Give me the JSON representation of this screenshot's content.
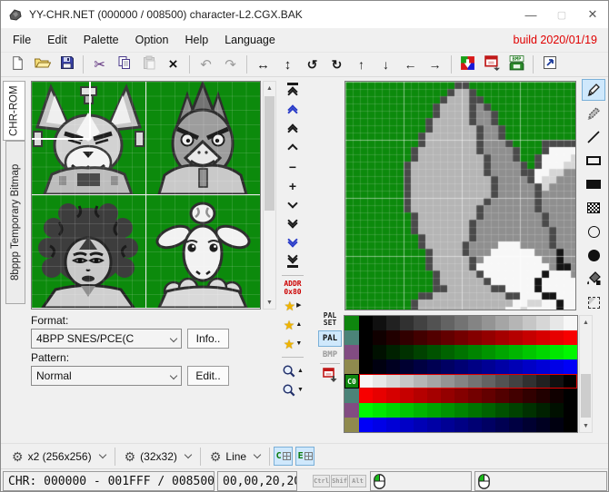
{
  "window": {
    "title": "YY-CHR.NET (000000 / 008500) character-L2.CGX.BAK",
    "build": "build 2020/01/19",
    "minimize_glyph": "—",
    "maximize_glyph": "▢",
    "close_glyph": "✕"
  },
  "menu": [
    "File",
    "Edit",
    "Palette",
    "Option",
    "Help",
    "Language"
  ],
  "toolbar": [
    {
      "icon": "new-file-icon",
      "enabled": true
    },
    {
      "icon": "open-file-icon",
      "enabled": true
    },
    {
      "icon": "save-file-icon",
      "enabled": true
    },
    {
      "type": "sep"
    },
    {
      "icon": "cut-icon",
      "enabled": true
    },
    {
      "icon": "copy-icon",
      "enabled": true
    },
    {
      "icon": "paste-icon",
      "enabled": false
    },
    {
      "icon": "delete-icon",
      "enabled": true
    },
    {
      "type": "sep"
    },
    {
      "icon": "undo-icon",
      "enabled": false
    },
    {
      "icon": "redo-icon",
      "enabled": false
    },
    {
      "type": "sep"
    },
    {
      "icon": "flip-horizontal-icon",
      "enabled": true
    },
    {
      "icon": "flip-vertical-icon",
      "enabled": true
    },
    {
      "icon": "rotate-left-icon",
      "enabled": true
    },
    {
      "icon": "rotate-right-icon",
      "enabled": true
    },
    {
      "icon": "shift-up-icon",
      "enabled": true
    },
    {
      "icon": "shift-down-icon",
      "enabled": true
    },
    {
      "icon": "shift-left-icon",
      "enabled": true
    },
    {
      "icon": "shift-right-icon",
      "enabled": true
    },
    {
      "type": "sep"
    },
    {
      "icon": "palette-editor-icon",
      "enabled": true
    },
    {
      "icon": "screen-capture-icon",
      "enabled": true
    },
    {
      "icon": "bmp-export-icon",
      "enabled": true
    },
    {
      "type": "sep"
    },
    {
      "icon": "popout-window-icon",
      "enabled": true
    }
  ],
  "tabs": [
    {
      "label": "CHR-ROM",
      "active": true
    },
    {
      "label": "8bppp Temporary Bitmap",
      "active": false
    }
  ],
  "nav": {
    "buttons": [
      {
        "icon": "jump-top-icon"
      },
      {
        "icon": "page-up-fast-icon"
      },
      {
        "icon": "page-up-8-icon"
      },
      {
        "icon": "row-up-icon"
      },
      {
        "icon": "minus-icon"
      },
      {
        "icon": "plus-icon"
      },
      {
        "icon": "row-down-icon"
      },
      {
        "icon": "page-down-8-icon"
      },
      {
        "icon": "page-down-fast-icon"
      },
      {
        "icon": "jump-bottom-icon"
      }
    ],
    "addr_line1": "ADDR",
    "addr_line2": "0x80",
    "bookmarks": [
      {
        "icon": "bookmark-go-icon",
        "arrow": "▶"
      },
      {
        "icon": "bookmark-prev-icon",
        "arrow": "▲"
      },
      {
        "icon": "bookmark-next-icon",
        "arrow": "▼"
      }
    ],
    "zoom_buttons": [
      {
        "icon": "zoom-in-icon",
        "arrow": "▲"
      },
      {
        "icon": "zoom-out-icon",
        "arrow": "▼"
      }
    ]
  },
  "tools": [
    {
      "icon": "pen-icon",
      "selected": true
    },
    {
      "icon": "dither-pen-icon",
      "selected": false
    },
    {
      "icon": "line-icon",
      "selected": false
    },
    {
      "icon": "rect-outline-icon",
      "selected": false
    },
    {
      "icon": "rect-fill-icon",
      "selected": false
    },
    {
      "icon": "dither-rect-icon",
      "selected": false
    },
    {
      "icon": "circle-outline-icon",
      "selected": false
    },
    {
      "icon": "circle-fill-icon",
      "selected": false
    },
    {
      "icon": "fill-bucket-icon",
      "selected": false
    },
    {
      "icon": "select-marquee-icon",
      "selected": false
    }
  ],
  "format": {
    "format_label": "Format:",
    "format_value": "4BPP SNES/PCE(C",
    "info_label": "Info..",
    "pattern_label": "Pattern:",
    "pattern_value": "Normal",
    "edit_label": "Edit.."
  },
  "palette": {
    "pal_set_label": "PAL SET",
    "pal_label": "PAL",
    "bmp_label": "BMP",
    "selected_row_label": "C0",
    "rows": [
      {
        "indicator": "#0e860e",
        "selected": false,
        "colors": [
          "#000000",
          "#101010",
          "#212121",
          "#313131",
          "#424242",
          "#525252",
          "#636363",
          "#737373",
          "#848484",
          "#949494",
          "#a5a5a5",
          "#b5b5b5",
          "#c6c6c6",
          "#d6d6d6",
          "#e7e7e7",
          "#f7f7f7"
        ]
      },
      {
        "indicator": "#4b8378",
        "selected": false,
        "colors": [
          "#000000",
          "#100000",
          "#210000",
          "#310000",
          "#420000",
          "#520000",
          "#630000",
          "#730000",
          "#840000",
          "#940000",
          "#a50000",
          "#b50000",
          "#c60000",
          "#d60000",
          "#e70000",
          "#f70000"
        ]
      },
      {
        "indicator": "#824c82",
        "selected": false,
        "colors": [
          "#000000",
          "#001000",
          "#002100",
          "#003100",
          "#004200",
          "#005200",
          "#006300",
          "#007300",
          "#008400",
          "#009400",
          "#00a500",
          "#00b500",
          "#00c600",
          "#00d600",
          "#00e700",
          "#00f700"
        ]
      },
      {
        "indicator": "#8f8a4e",
        "selected": false,
        "colors": [
          "#000000",
          "#000010",
          "#000021",
          "#000031",
          "#000042",
          "#000052",
          "#000063",
          "#000073",
          "#000084",
          "#000094",
          "#0000a5",
          "#0000b5",
          "#0000c6",
          "#0000d6",
          "#0000e7",
          "#0000f7"
        ]
      },
      {
        "indicator": "#0e860e",
        "selected": true,
        "label": "C0",
        "colors": [
          "#f7f7f7",
          "#e7e7e7",
          "#d6d6d6",
          "#c6c6c6",
          "#b5b5b5",
          "#a5a5a5",
          "#949494",
          "#848484",
          "#737373",
          "#636363",
          "#525252",
          "#424242",
          "#313131",
          "#212121",
          "#101010",
          "#000000"
        ]
      },
      {
        "indicator": "#4b8378",
        "selected": false,
        "colors": [
          "#f70000",
          "#e70000",
          "#d60000",
          "#c60000",
          "#b50000",
          "#a50000",
          "#940000",
          "#840000",
          "#730000",
          "#630000",
          "#520000",
          "#420000",
          "#310000",
          "#210000",
          "#100000",
          "#000000"
        ]
      },
      {
        "indicator": "#824c82",
        "selected": false,
        "colors": [
          "#00f700",
          "#00e700",
          "#00d600",
          "#00c600",
          "#00b500",
          "#00a500",
          "#009400",
          "#008400",
          "#007300",
          "#006300",
          "#005200",
          "#004200",
          "#003100",
          "#002100",
          "#001000",
          "#000000"
        ]
      },
      {
        "indicator": "#8f8a4e",
        "selected": false,
        "colors": [
          "#0000f7",
          "#0000e7",
          "#0000d6",
          "#0000c6",
          "#0000b5",
          "#0000a5",
          "#000094",
          "#000084",
          "#000073",
          "#000063",
          "#000052",
          "#000042",
          "#000031",
          "#000021",
          "#000010",
          "#000000"
        ]
      }
    ]
  },
  "editor": {
    "palette_map": {
      "G": "#0c8a0c",
      "D": "#4a4a4a",
      "L": "#b5b5b5",
      "M": "#8f8f8f",
      "W": "#f7f7f7",
      "S": "#d6d6d6",
      "K": "#141414"
    },
    "pixel_map": [
      "GGGGGGGGGGGGGGGDDGGGGGGGGGGGGGGG",
      "GGGGGGGGGGGGGGDLLDGGGGGGGGGGGGGG",
      "GGGGGGGGGGGGGDLLLDDGGGGGGGGGGGGG",
      "GGGGGGGGGGGGDLLLLDMDGGGGGGGGGGGG",
      "GGGGGGGGGGGGDLLLLDMMDGGGGGGGGGGG",
      "GGGGGGGGGGGDLLLLLDMMDGGGGGGGGGGG",
      "GGGGGGGGGGGDLLLLLLDMMDGGGGGGGGGG",
      "GGGGGGGGGGDLLLLLLLDMMDGGGGGGGGGG",
      "GGGGGGGGGGDLLLLLLLDMMMDGGGGDDDDD",
      "GGGGGGGGGDLLLLLLLLDMMMMDGGGDWWWW",
      "GGGGGGGGGDLLLLLLLLLDMMMDGGDWWWWS",
      "GGGGGGGGDLLLLLLLLLLDMMMMDGDWWWSS",
      "GGGGGGGGDLLLLLLLLLLDMMMMDDWWSSMM",
      "GGGGGGGGDLLLLLLLLLLLDMMMMDWSSMMM",
      "GGGGGGGGDLLLLLLLLLLLDMMMMMDSMMMM",
      "GGGGGGGGDLLLLLLLLLLLDMMMMMDMMMMM",
      "GGGGGGGGDLLLLLLLLLLDMMMMMMDMMMMM",
      "GGGGGGGGDLLLLLLLLLDMMMMMMMDMMMMM",
      "GGGGGGGGGDLLLLLLLLDMMMMMMMMDMMMM",
      "GGGGGGGGGDLLLLLLLDMMMMMMMMMDMMMM",
      "GGGGGGGGGDLLLLLLLDMMMMMMMMMMDMMM",
      "GGGGGGGGGGDLLLLLLDMMMMMMMMMMDMMM",
      "GGGGGGGGGGDLLLLLDMMMMWWWMMMMDMMM",
      "GGGGGGGGGGGDLLLLDMMMWWWWWWMMMKMM",
      "GGGGGGGGGGGDLLLLLDMWWWWWWWWMMKMM",
      "GGGGGGGGGGGDLLLLLDWWWWWWWWWWMKKM",
      "GGGGGGGGGGGGDLLLLLDWWWWWWWWKWWWM",
      "GGGGGGGGGGGGDLLLLLLDWWWWWWKWWWWW",
      "GGGGGGGGGGGGDDLLLLLLDDWWWWKWWWWW",
      "GGGGGGGGGGDDLLLLLLLLLLDDWWWKKWWW",
      "GGGGGGGGGDLLLLLLLLLLLLLWWSSWWKWW",
      "GGGGGGGGGDLLLLLLLLLLLLWWSWWWWKWW"
    ]
  },
  "bottombar": {
    "zoom_label": "x2 (256x256)",
    "tile_label": "(32x32)",
    "mode_label": "Line",
    "toggle_c": "C",
    "toggle_e": "E"
  },
  "status": {
    "chr_text": "CHR: 000000 - 001FFF / 008500",
    "coord_text": "00,00,20,20",
    "key_labels": [
      "Ctrl",
      "Shif",
      "Alt"
    ]
  },
  "colors": {
    "canvas_green": "#0c8a0c",
    "accent_blue": "#cfe8fc",
    "build_red": "#e00000",
    "selection_red": "#e00000"
  }
}
